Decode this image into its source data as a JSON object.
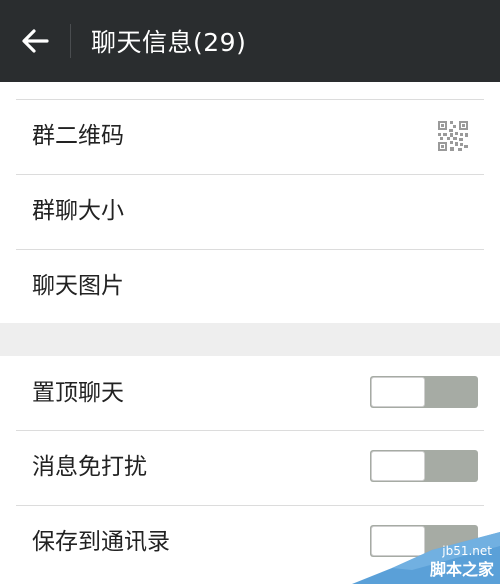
{
  "appbar": {
    "title": "聊天信息(29)",
    "background": "#2a2d2f"
  },
  "section1": {
    "items": [
      {
        "label": "群二维码",
        "icon": "qr-code-icon"
      },
      {
        "label": "群聊大小"
      },
      {
        "label": "聊天图片"
      }
    ]
  },
  "section2": {
    "items": [
      {
        "label": "置顶聊天",
        "toggle_on": false
      },
      {
        "label": "消息免打扰",
        "toggle_on": false
      },
      {
        "label": "保存到通讯录",
        "toggle_on": false
      }
    ]
  },
  "watermark": {
    "line1": "jb51.net",
    "line2": "脚本之家"
  },
  "colors": {
    "toggle_track": "#a6aba4",
    "section_gap": "#eeeeee"
  }
}
